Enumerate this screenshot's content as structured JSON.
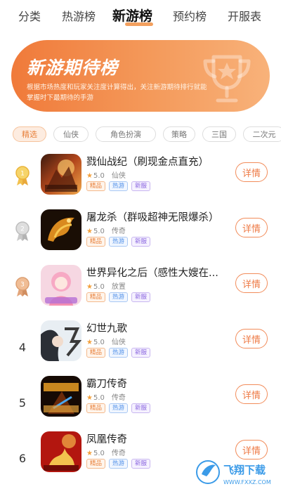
{
  "top_tabs": [
    {
      "label": "分类",
      "active": false
    },
    {
      "label": "热游榜",
      "active": false
    },
    {
      "label": "新游榜",
      "active": true
    },
    {
      "label": "预约榜",
      "active": false
    },
    {
      "label": "开服表",
      "active": false
    }
  ],
  "banner": {
    "title": "新游期待榜",
    "description": "根据市场热度和玩家关注度计算得出，关注新游期待排行就能掌握时下最期待的手游",
    "icon": "trophy-icon"
  },
  "filters": [
    {
      "label": "精选",
      "active": true
    },
    {
      "label": "仙侠",
      "active": false
    },
    {
      "label": "角色扮演",
      "active": false
    },
    {
      "label": "策略",
      "active": false
    },
    {
      "label": "三国",
      "active": false
    },
    {
      "label": "二次元",
      "active": false
    }
  ],
  "games": [
    {
      "rank": "1",
      "medal": "gold",
      "name": "戮仙战纪（刷现金点直充）",
      "score": "5.0",
      "genre": "仙侠",
      "tags": [
        "精品",
        "热游",
        "新服"
      ],
      "action": "详情"
    },
    {
      "rank": "2",
      "medal": "silver",
      "name": "屠龙杀（群吸超神无限爆杀）",
      "score": "5.0",
      "genre": "传奇",
      "tags": [
        "精品",
        "热游",
        "新服"
      ],
      "action": "详情"
    },
    {
      "rank": "3",
      "medal": "bronze",
      "name": "世界异化之后（感性大嫂在...",
      "score": "5.0",
      "genre": "放置",
      "tags": [
        "精品",
        "热游",
        "新服"
      ],
      "action": "详情"
    },
    {
      "rank": "4",
      "medal": "",
      "name": "幻世九歌",
      "score": "5.0",
      "genre": "仙侠",
      "tags": [
        "精品",
        "热游",
        "新服"
      ],
      "action": "详情"
    },
    {
      "rank": "5",
      "medal": "",
      "name": "霸刀传奇",
      "score": "5.0",
      "genre": "传奇",
      "tags": [
        "精品",
        "热游",
        "新服"
      ],
      "action": "详情"
    },
    {
      "rank": "6",
      "medal": "",
      "name": "凤凰传奇",
      "score": "5.0",
      "genre": "传奇",
      "tags": [
        "精品",
        "热游",
        "新服"
      ],
      "action": "详情"
    }
  ],
  "watermark": {
    "brand": "飞翔下载",
    "url": "WWW.FXXZ.COM"
  },
  "colors": {
    "accent": "#f07a3a",
    "medal_gold": "#f2c14e",
    "medal_silver": "#c9c9c9",
    "medal_bronze": "#e3a57a"
  }
}
